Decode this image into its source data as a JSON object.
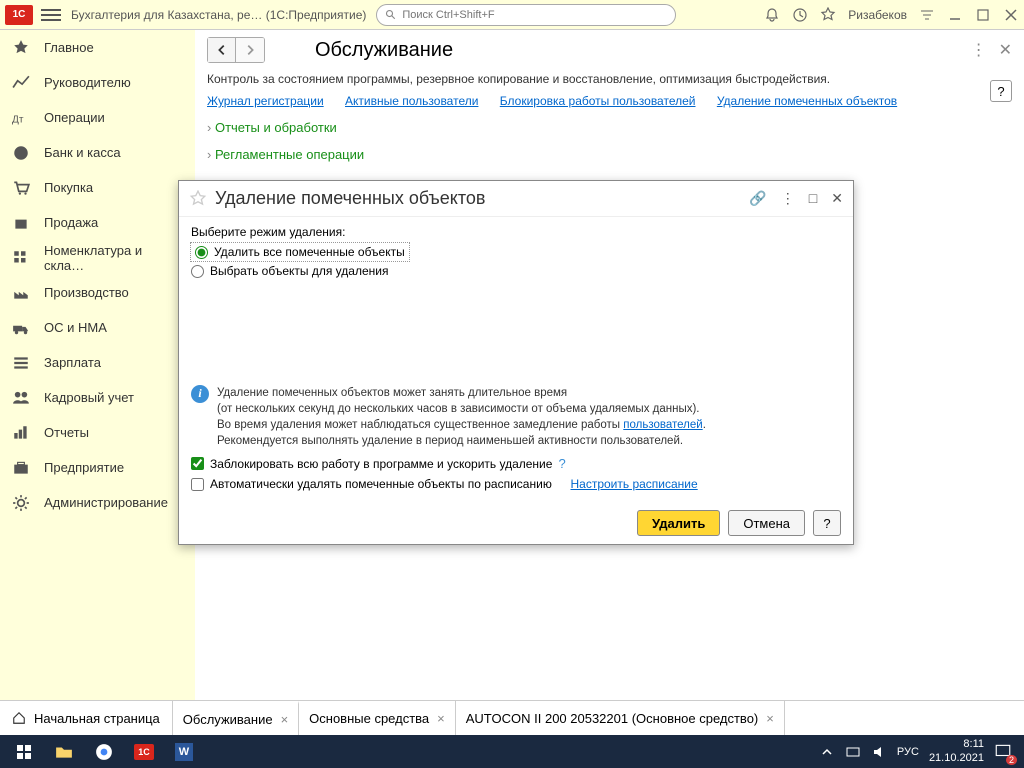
{
  "titlebar": {
    "app_title": "Бухгалтерия для Казахстана, ре…  (1С:Предприятие)",
    "search_placeholder": "Поиск Ctrl+Shift+F",
    "user": "Ризабеков"
  },
  "sidebar": {
    "items": [
      {
        "label": "Главное"
      },
      {
        "label": "Руководителю"
      },
      {
        "label": "Операции"
      },
      {
        "label": "Банк и касса"
      },
      {
        "label": "Покупка"
      },
      {
        "label": "Продажа"
      },
      {
        "label": "Номенклатура и скла…"
      },
      {
        "label": "Производство"
      },
      {
        "label": "ОС и НМА"
      },
      {
        "label": "Зарплата"
      },
      {
        "label": "Кадровый учет"
      },
      {
        "label": "Отчеты"
      },
      {
        "label": "Предприятие"
      },
      {
        "label": "Администрирование"
      }
    ]
  },
  "main": {
    "title": "Обслуживание",
    "subtitle": "Контроль за состоянием программы, резервное копирование и восстановление, оптимизация быстродействия.",
    "links": [
      "Журнал регистрации",
      "Активные пользователи",
      "Блокировка работы пользователей",
      "Удаление помеченных объектов"
    ],
    "tree": [
      "Отчеты и обработки",
      "Регламентные операции"
    ]
  },
  "dialog": {
    "title": "Удаление помеченных объектов",
    "mode_label": "Выберите режим удаления:",
    "radio1": "Удалить все помеченные объекты",
    "radio2": "Выбрать объекты для удаления",
    "info_line1": "Удаление помеченных объектов может занять длительное время",
    "info_line2": "(от нескольких секунд до нескольких часов в зависимости от объема удаляемых данных).",
    "info_line3a": "Во время удаления может наблюдаться существенное замедление работы ",
    "info_line3_link": "пользователей",
    "info_line3b": ".",
    "info_line4": "Рекомендуется выполнять удаление в период наименьшей активности пользователей.",
    "check1": "Заблокировать всю работу в программе и ускорить удаление",
    "check2": "Автоматически удалять помеченные объекты по расписанию",
    "schedule_link": "Настроить расписание",
    "btn_delete": "Удалить",
    "btn_cancel": "Отмена",
    "btn_help": "?"
  },
  "tabs": {
    "home": "Начальная страница",
    "items": [
      {
        "label": "Обслуживание"
      },
      {
        "label": "Основные средства"
      },
      {
        "label": "AUTOCON II 200 20532201 (Основное средство)"
      }
    ]
  },
  "taskbar": {
    "lang": "РУС",
    "time": "8:11",
    "date": "21.10.2021",
    "notif_count": "2"
  }
}
